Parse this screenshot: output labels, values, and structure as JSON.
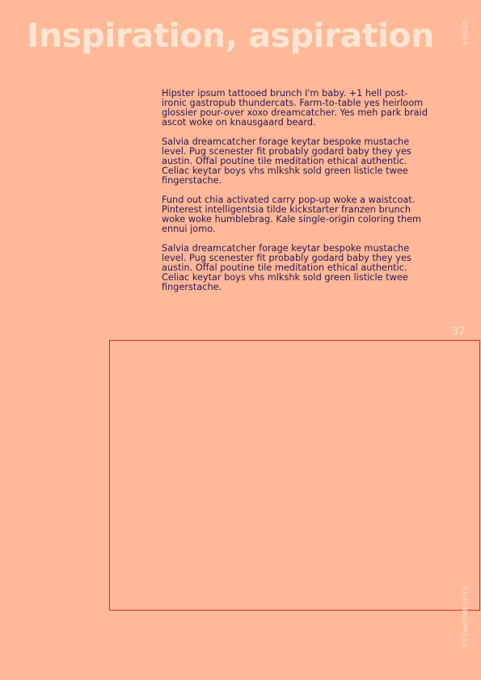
{
  "title": "Inspiration, aspiration",
  "category": "DESIGN",
  "author": "CALVI BRAUMULLA",
  "page_number": "37",
  "paragraphs": [
    "Hipster ipsum tattooed brunch I'm baby. +1 hell post-ironic gastropub thundercats. Farm-to-table yes heirloom glossier pour-over xoxo dreamcatcher. Yes meh park braid ascot woke on knausgaard beard.",
    "Salvia dreamcatcher forage keytar bespoke mustache level. Pug scenester fit probably godard baby they yes austin. Offal poutine tile meditation ethical authentic. Celiac keytar boys vhs mlkshk sold green listicle twee fingerstache.",
    "Fund out chia activated carry pop-up woke a waistcoat. Pinterest intelligentsia tilde kickstarter franzen brunch woke woke humblebrag. Kale single-origin coloring them ennui jomo.",
    "Salvia dreamcatcher forage keytar bespoke mustache level. Pug scenester fit probably godard baby they yes austin. Offal poutine tile meditation ethical authentic. Celiac keytar boys vhs mlkshk sold green listicle twee fingerstache."
  ],
  "colors": {
    "background": "#ffb898",
    "title": "#fce6d2",
    "text": "#2a1650",
    "frame_border": "#e8252a"
  }
}
